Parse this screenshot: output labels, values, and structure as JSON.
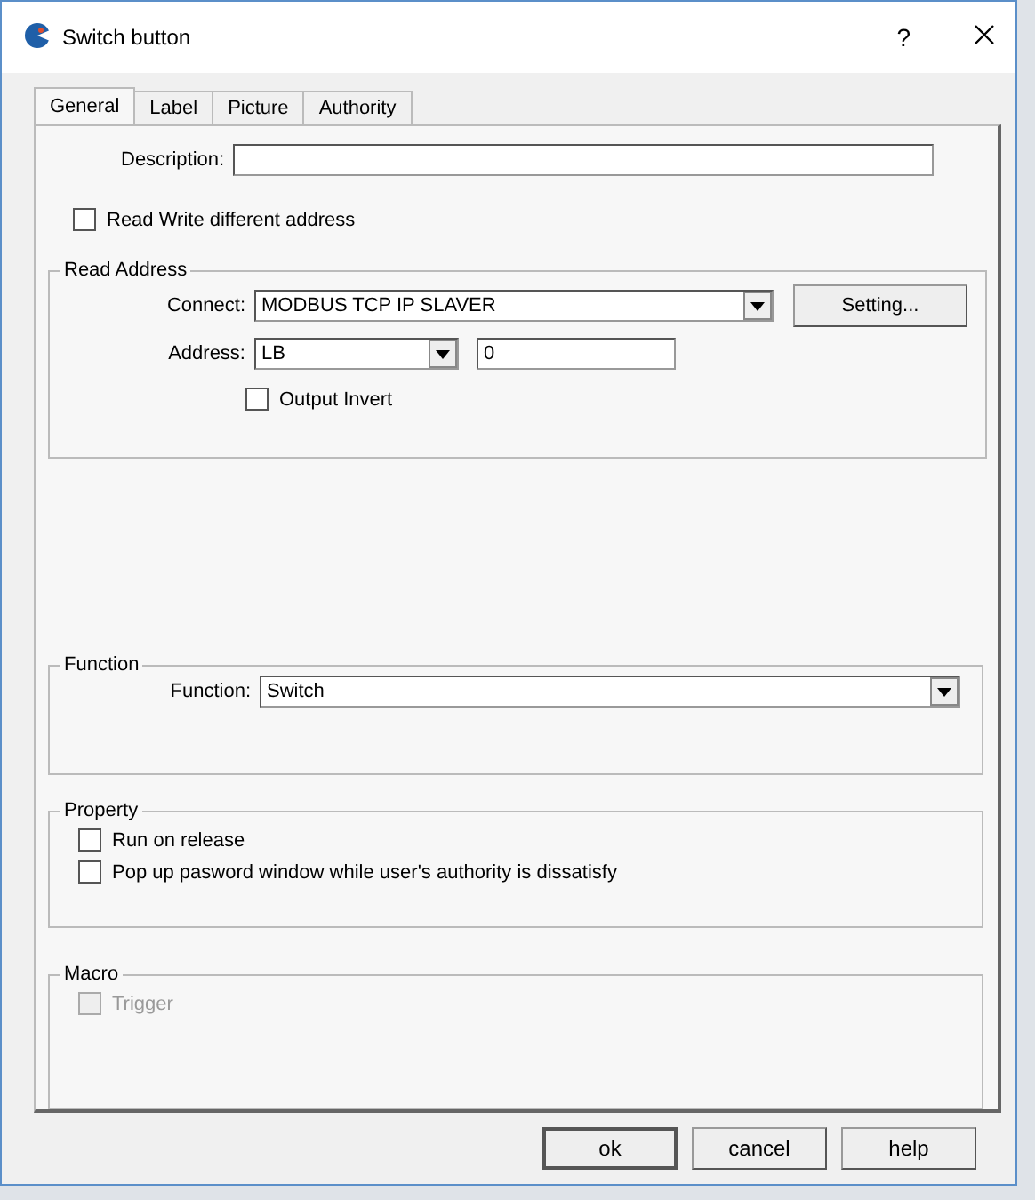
{
  "window": {
    "title": "Switch button",
    "help": "?"
  },
  "tabs": [
    {
      "label": "General",
      "selected": true
    },
    {
      "label": "Label",
      "selected": false
    },
    {
      "label": "Picture",
      "selected": false
    },
    {
      "label": "Authority",
      "selected": false
    }
  ],
  "description": {
    "label": "Description:"
  },
  "read_write_different": {
    "label": "Read Write different address",
    "checked": false,
    "disabled": false
  },
  "groups": [
    {
      "title": "Read Address",
      "rows": [
        {
          "kind": "combo",
          "label": "Connect:",
          "value": "MODBUS TCP IP SLAVER",
          "button": "Setting..."
        },
        {
          "kind": "address",
          "label": "Address:",
          "value": "LB",
          "number": "0"
        },
        {
          "kind": "checkbox",
          "label": "Output Invert",
          "checked": false,
          "disabled": false
        }
      ]
    },
    {
      "title": "Function",
      "rows": [
        {
          "kind": "wide-combo",
          "label": "Function:",
          "value": "Switch"
        }
      ]
    },
    {
      "title": "Property",
      "rows": [
        {
          "kind": "checkbox",
          "label": "Run on release",
          "checked": false,
          "disabled": false
        },
        {
          "kind": "checkbox",
          "label": "Pop up pasword window while user's authority is dissatisfy",
          "checked": false,
          "disabled": false
        }
      ]
    },
    {
      "title": "Macro",
      "rows": [
        {
          "kind": "checkbox",
          "label": "Trigger",
          "checked": false,
          "disabled": true
        }
      ]
    }
  ],
  "buttons": [
    {
      "label": "ok",
      "default": true
    },
    {
      "label": "cancel",
      "default": false
    },
    {
      "label": "help",
      "default": false
    }
  ]
}
